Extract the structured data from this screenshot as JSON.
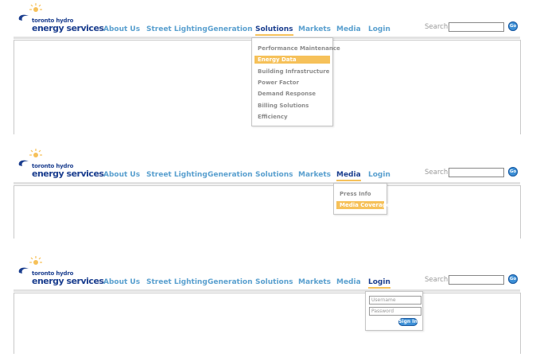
{
  "panels": [
    {
      "logo": {
        "small": "toronto hydro",
        "big": "energy services"
      },
      "nav": [
        "About Us",
        "Street Lighting",
        "Generation",
        "Solutions",
        "Markets",
        "Media",
        "Login"
      ],
      "active": "Solutions",
      "search_label": "Search",
      "go_label": "Go",
      "dropdown": [
        "Performance Maintenance",
        "Energy Data",
        "Building Infrastructure",
        "Power Factor",
        "Demand Response",
        "Billing Solutions",
        "Efficiency"
      ],
      "highlighted": "Energy Data"
    },
    {
      "logo": {
        "small": "toronto hydro",
        "big": "energy services"
      },
      "nav": [
        "About Us",
        "Street Lighting",
        "Generation",
        "Solutions",
        "Markets",
        "Media",
        "Login"
      ],
      "active": "Media",
      "search_label": "Search",
      "go_label": "Go",
      "dropdown": [
        "Press Info",
        "Media Coverage"
      ],
      "highlighted": "Media Coverage"
    },
    {
      "logo": {
        "small": "toronto hydro",
        "big": "energy services"
      },
      "nav": [
        "About Us",
        "Street Lighting",
        "Generation",
        "Solutions",
        "Markets",
        "Media",
        "Login"
      ],
      "active": "Login",
      "search_label": "Search",
      "go_label": "Go",
      "login": {
        "username_placeholder": "Username",
        "password_placeholder": "Password",
        "signin_label": "Sign In"
      }
    }
  ],
  "colors": {
    "nav": "#5aa0cf",
    "nav_active": "#1c3f8f",
    "accent": "#f6c15a",
    "button": "#3c8fd6"
  }
}
